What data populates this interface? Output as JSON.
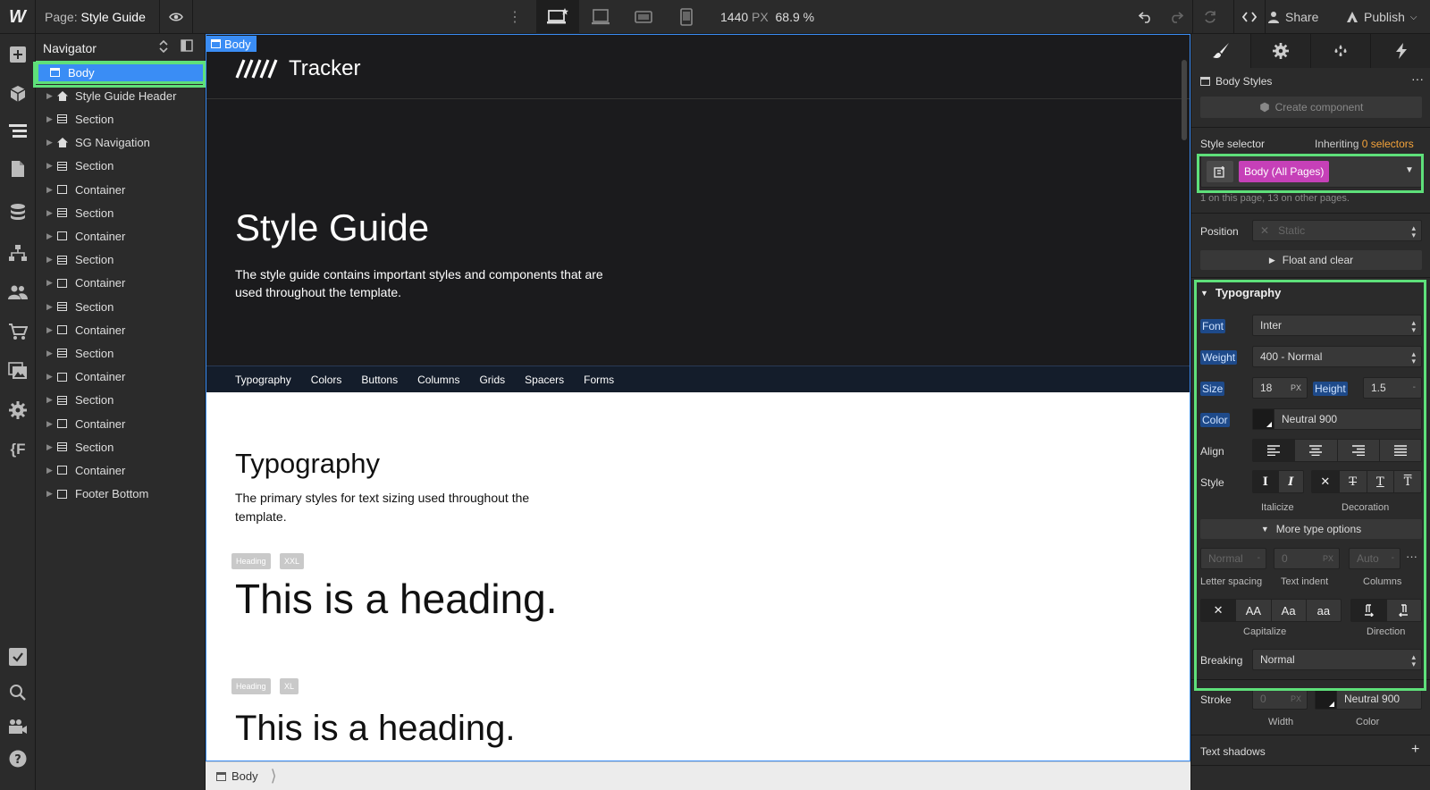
{
  "topbar": {
    "logo": "W",
    "page_prefix": "Page:",
    "page_name": "Style Guide",
    "width_value": "1440",
    "width_unit": "PX",
    "zoom": "68.9 %",
    "share_label": "Share",
    "publish_label": "Publish"
  },
  "navigator": {
    "title": "Navigator",
    "items": [
      {
        "label": "Body",
        "icon": "body-icon"
      },
      {
        "label": "Style Guide Header",
        "icon": "home-icon"
      },
      {
        "label": "Section",
        "icon": "section-icon"
      },
      {
        "label": "SG Navigation",
        "icon": "home-icon"
      },
      {
        "label": "Section",
        "icon": "section-icon"
      },
      {
        "label": "Container",
        "icon": "container-icon"
      },
      {
        "label": "Section",
        "icon": "section-icon"
      },
      {
        "label": "Container",
        "icon": "container-icon"
      },
      {
        "label": "Section",
        "icon": "section-icon"
      },
      {
        "label": "Container",
        "icon": "container-icon"
      },
      {
        "label": "Section",
        "icon": "section-icon"
      },
      {
        "label": "Container",
        "icon": "container-icon"
      },
      {
        "label": "Section",
        "icon": "section-icon"
      },
      {
        "label": "Container",
        "icon": "container-icon"
      },
      {
        "label": "Section",
        "icon": "section-icon"
      },
      {
        "label": "Container",
        "icon": "container-icon"
      },
      {
        "label": "Section",
        "icon": "section-icon"
      },
      {
        "label": "Container",
        "icon": "container-icon"
      },
      {
        "label": "Footer Bottom",
        "icon": "container-icon"
      }
    ]
  },
  "canvas": {
    "body_tag": "Body",
    "brand": "Tracker",
    "title": "Style Guide",
    "description": "The style guide contains important styles and components that are used throughout the template.",
    "nav_links": [
      "Typography",
      "Colors",
      "Buttons",
      "Columns",
      "Grids",
      "Spacers",
      "Forms"
    ],
    "typo_title": "Typography",
    "typo_desc": "The primary styles for text sizing used throughout the template.",
    "badge_heading": "Heading",
    "badge_xxl": "XXL",
    "badge_xl": "XL",
    "heading_xxl": "This is a heading.",
    "heading_xl": "This is a heading."
  },
  "breadcrumb": {
    "item": "Body"
  },
  "style_panel": {
    "body_styles": "Body Styles",
    "create_component": "Create component",
    "style_selector": "Style selector",
    "inheriting_prefix": "Inheriting",
    "inheriting_count": "0 selectors",
    "selector_chip": "Body (All Pages)",
    "selector_chip_color": "#c640b8",
    "usage_note": "1 on this page, 13 on other pages.",
    "position_label": "Position",
    "position_value": "Static",
    "float_clear": "Float and clear",
    "typography_title": "Typography",
    "font_label": "Font",
    "font_value": "Inter",
    "weight_label": "Weight",
    "weight_value": "400 - Normal",
    "size_label": "Size",
    "size_value": "18",
    "size_unit": "PX",
    "height_label": "Height",
    "height_value": "1.5",
    "height_unit": "-",
    "color_label": "Color",
    "color_value": "Neutral 900",
    "align_label": "Align",
    "style_label": "Style",
    "italicize_label": "Italicize",
    "decoration_label": "Decoration",
    "more_type": "More type options",
    "letter_spacing_value": "Normal",
    "letter_spacing_unit": "-",
    "text_indent_value": "0",
    "text_indent_unit": "PX",
    "columns_value": "Auto",
    "columns_unit": "-",
    "letter_spacing_label": "Letter spacing",
    "text_indent_label": "Text indent",
    "columns_label": "Columns",
    "capitalize_label": "Capitalize",
    "direction_label": "Direction",
    "cap_options": [
      "AA",
      "Aa",
      "aa"
    ],
    "breaking_label": "Breaking",
    "breaking_value": "Normal",
    "stroke_label": "Stroke",
    "stroke_width_value": "0",
    "stroke_width_unit": "PX",
    "stroke_color": "Neutral 900",
    "width_label": "Width",
    "color_sub_label": "Color",
    "text_shadows": "Text shadows"
  },
  "colors": {
    "accent": "#3a8df5",
    "highlight": "#5ee07a",
    "warning": "#f5a33a"
  }
}
